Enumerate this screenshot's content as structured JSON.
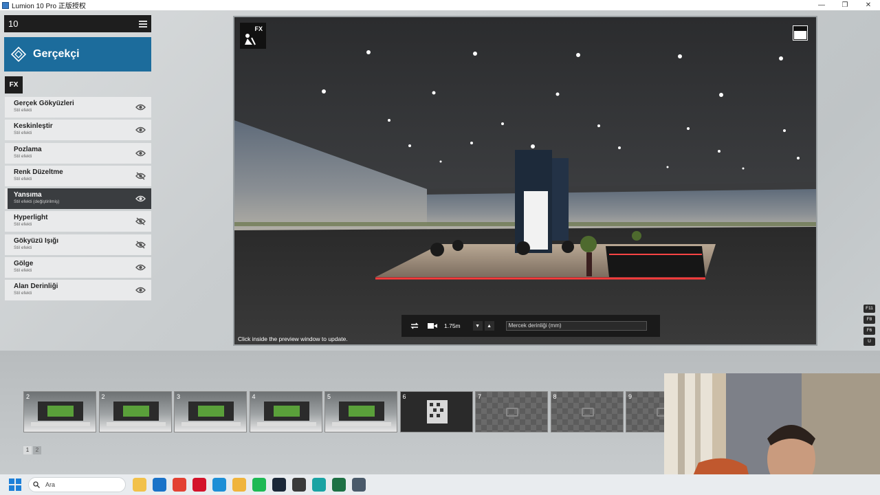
{
  "window": {
    "title": "Lumion 10 Pro 正版授权",
    "controls": [
      "—",
      "❐",
      "✕"
    ]
  },
  "panel": {
    "number": "10",
    "mode_label": "Gerçekçi",
    "fx_tag": "FX",
    "effects": [
      {
        "name": "Gerçek Gökyüzleri",
        "sub": "Stil efekti",
        "visible": true,
        "active": false
      },
      {
        "name": "Keskinleştir",
        "sub": "Stil efekti",
        "visible": true,
        "active": false
      },
      {
        "name": "Pozlama",
        "sub": "Stil efekti",
        "visible": true,
        "active": false
      },
      {
        "name": "Renk Düzeltme",
        "sub": "Stil efekti",
        "visible": false,
        "active": false
      },
      {
        "name": "Yansıma",
        "sub": "Stil efekti (değiştirilmiş)",
        "visible": true,
        "active": true
      },
      {
        "name": "Hyperlight",
        "sub": "Stil efekti",
        "visible": false,
        "active": false
      },
      {
        "name": "Gökyüzü Işığı",
        "sub": "Stil efekti",
        "visible": false,
        "active": false
      },
      {
        "name": "Gölge",
        "sub": "Stil efekti",
        "visible": true,
        "active": false
      },
      {
        "name": "Alan Derinliği",
        "sub": "Stil efekti",
        "visible": true,
        "active": false
      }
    ]
  },
  "preview": {
    "fx_badge": "FX",
    "hint": "Click inside the preview window to update.",
    "camera_height": "1.75m",
    "lens_label": "Mercek derinliği (mm)"
  },
  "shortcuts": [
    "F11",
    "F8",
    "F6",
    "U"
  ],
  "thumbnails": [
    {
      "n": "2",
      "state": "filled"
    },
    {
      "n": "2",
      "state": "filled"
    },
    {
      "n": "3",
      "state": "filled"
    },
    {
      "n": "4",
      "state": "filled"
    },
    {
      "n": "5",
      "state": "filled"
    },
    {
      "n": "6",
      "state": "dark"
    },
    {
      "n": "7",
      "state": "empty"
    },
    {
      "n": "8",
      "state": "empty"
    },
    {
      "n": "9",
      "state": "empty"
    }
  ],
  "pages": [
    "1",
    "2"
  ],
  "taskbar": {
    "search_placeholder": "Ara",
    "apps": [
      {
        "name": "file-explorer-icon",
        "color": "#f2c14a"
      },
      {
        "name": "outlook-icon",
        "color": "#1a73c8"
      },
      {
        "name": "chrome-icon",
        "color": "#e34133"
      },
      {
        "name": "opera-icon",
        "color": "#d4132b"
      },
      {
        "name": "edge-icon",
        "color": "#1e8fd6"
      },
      {
        "name": "folder-icon",
        "color": "#f0b43c"
      },
      {
        "name": "spotify-icon",
        "color": "#1db954"
      },
      {
        "name": "steam-icon",
        "color": "#1b2838"
      },
      {
        "name": "obs-icon",
        "color": "#3a3a3a"
      },
      {
        "name": "3dsmax-icon",
        "color": "#1aa3a3"
      },
      {
        "name": "excel-icon",
        "color": "#1d7044"
      },
      {
        "name": "lumion-icon",
        "color": "#4a5a6a"
      }
    ]
  }
}
